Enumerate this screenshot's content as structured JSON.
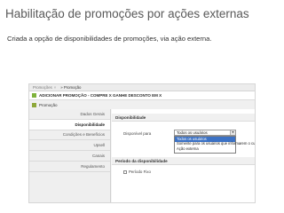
{
  "slide": {
    "title": "Habilitação de promoções por ações externas",
    "subtitle": "Criada a opção de disponibilidades de promoções, via ação externa."
  },
  "screenshot": {
    "breadcrumb": {
      "parent": "Promoções",
      "close_glyph": "×",
      "current": "» Promoção"
    },
    "promotion_title": "ADICIONAR PROMOÇÃO - COMPRE X GANHE DESCONTO EM X",
    "section_label": "Promoção",
    "nav": {
      "items": [
        {
          "label": "Dados Gerais",
          "active": false
        },
        {
          "label": "Disponibilidade",
          "active": true
        },
        {
          "label": "Condições e Benefícios",
          "active": false
        },
        {
          "label": "Upsell",
          "active": false
        },
        {
          "label": "Canais",
          "active": false
        },
        {
          "label": "Regulamento",
          "active": false
        }
      ]
    },
    "availability": {
      "header": "Disponibilidade",
      "field_label": "Disponível para",
      "selected_value": "Todos os usuários",
      "options": [
        "Todos os usuários",
        "Somente para os usuários que informarem o cupom",
        "Ação externa"
      ]
    },
    "period": {
      "header": "Período da disponibilidade",
      "checkbox_label": "Período Fixo",
      "checked": false
    },
    "colors": {
      "active_option": "#3c72c5",
      "title_icon": "#7fb33c"
    }
  }
}
